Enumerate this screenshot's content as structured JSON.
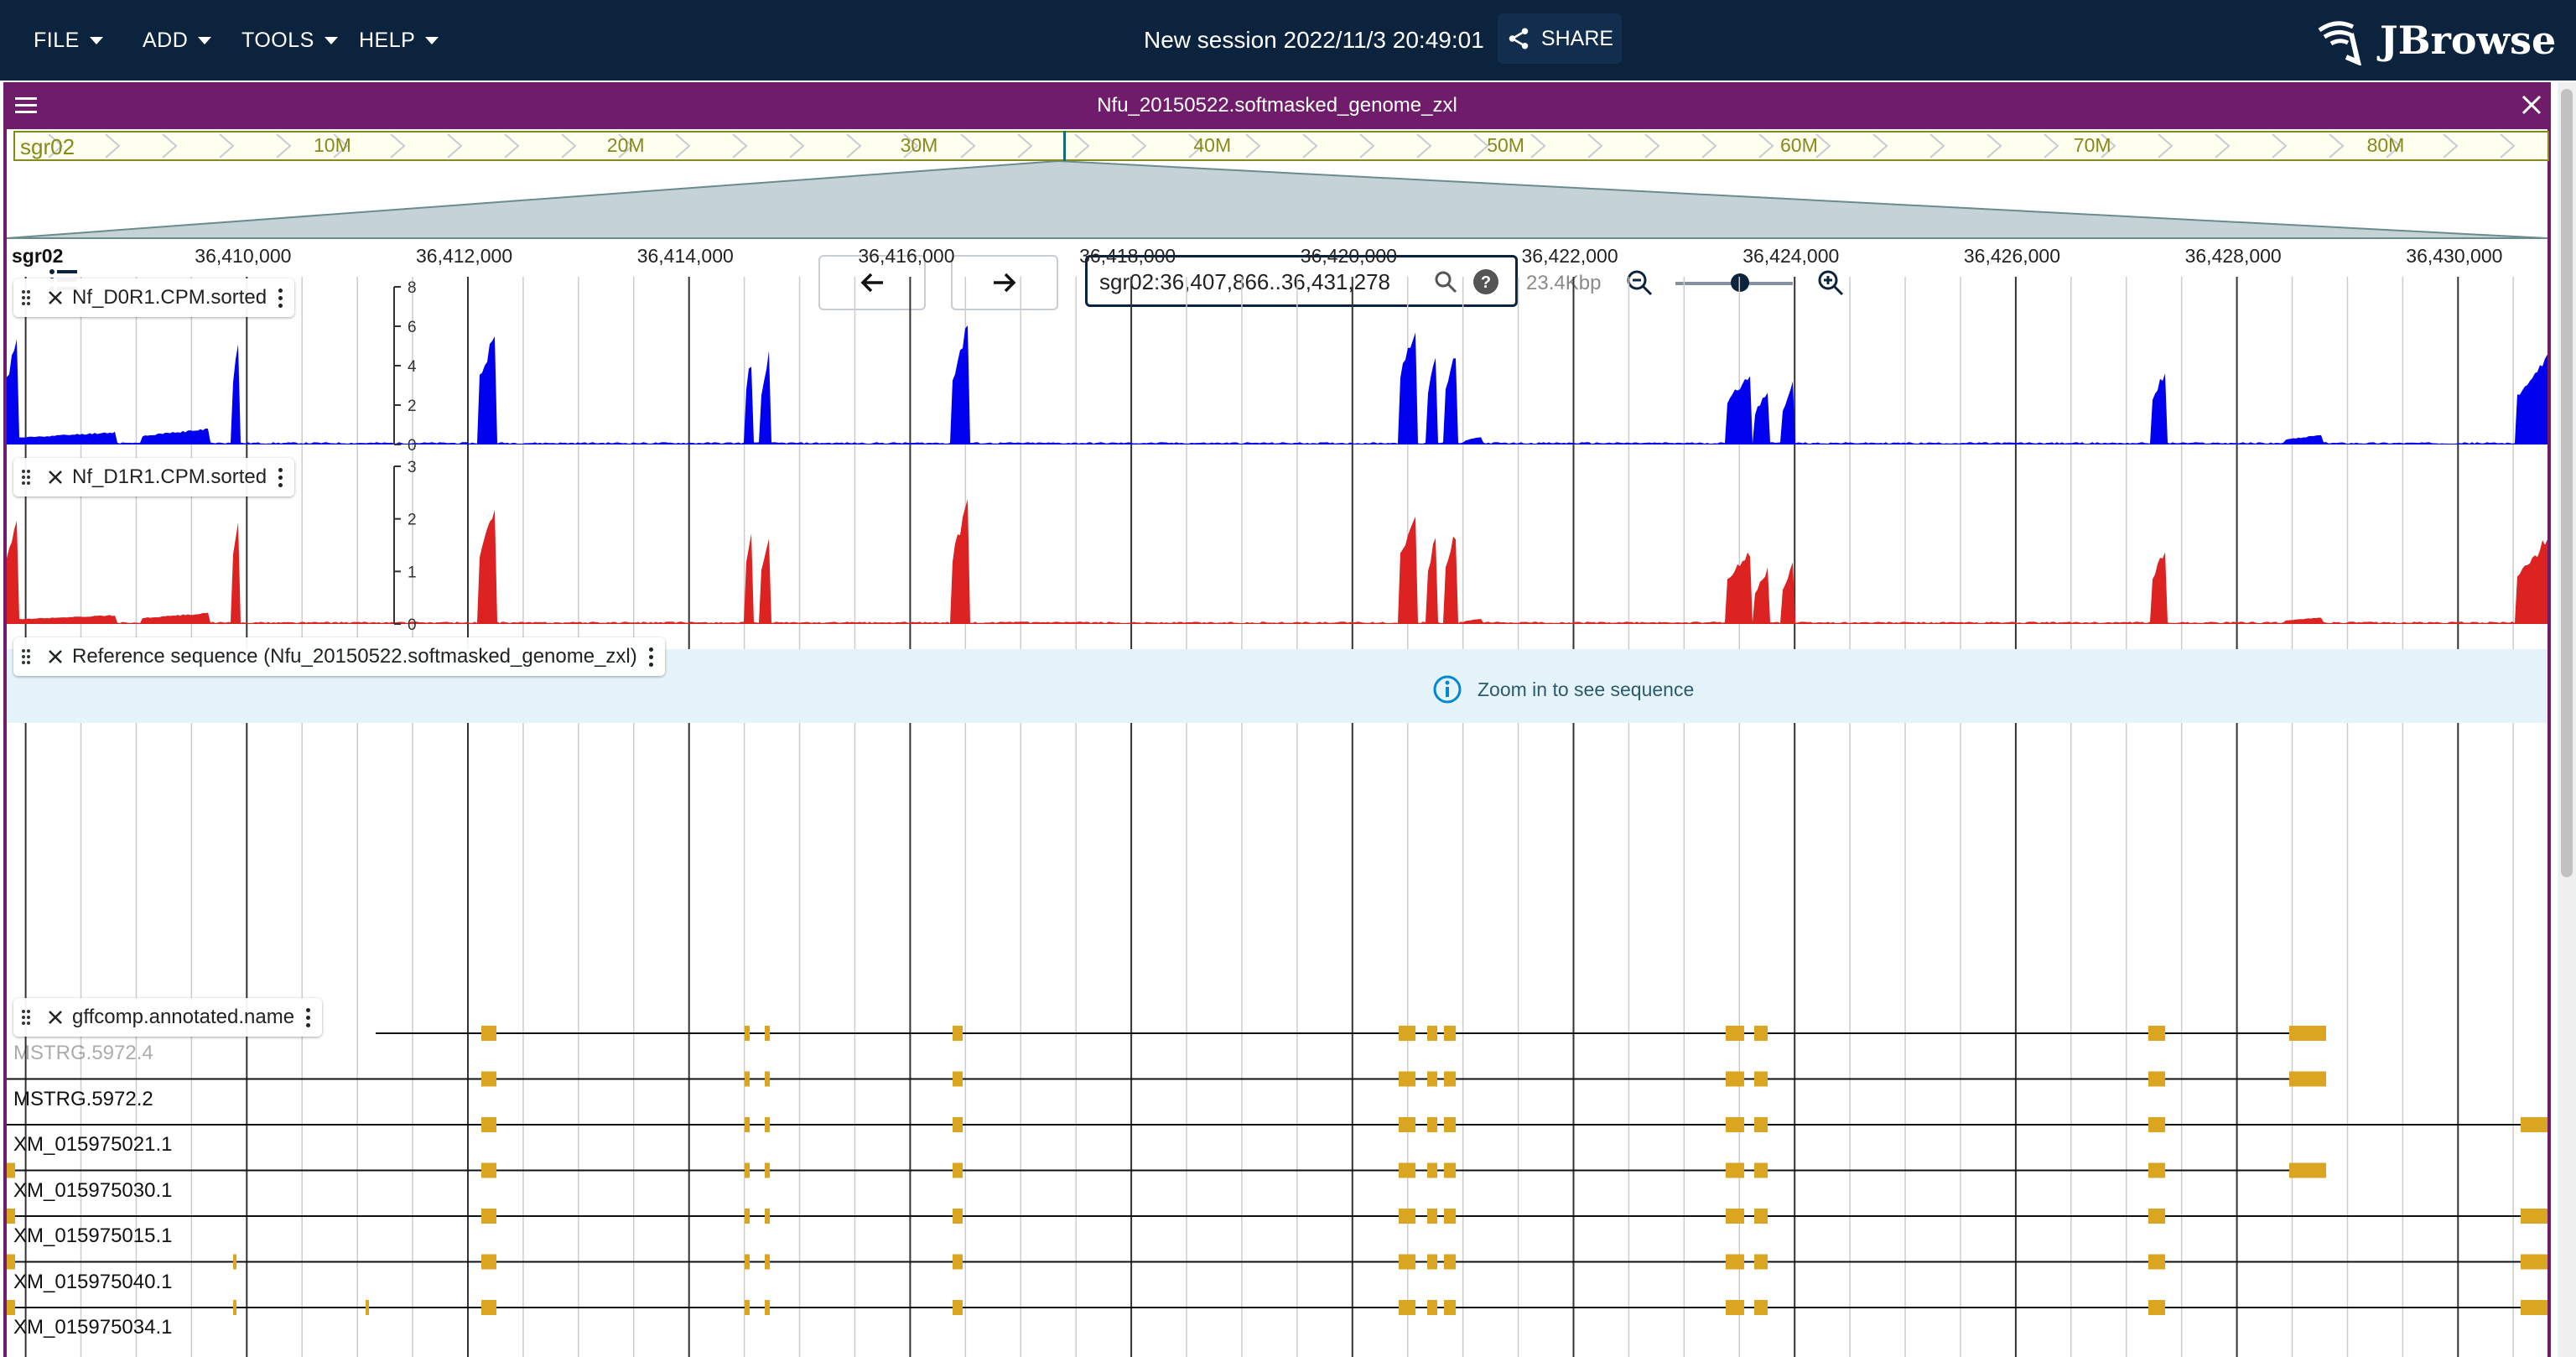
{
  "menus": [
    "FILE",
    "ADD",
    "TOOLS",
    "HELP"
  ],
  "session_title": "New session 2022/11/3 20:49:01",
  "share_label": "SHARE",
  "logo_text": "JBrowse",
  "view": {
    "title": "Nfu_20150522.softmasked_genome_zxl",
    "chrom": "sgr02",
    "overview_labels": [
      "10M",
      "20M",
      "30M",
      "40M",
      "50M",
      "60M",
      "70M",
      "80M"
    ],
    "location": "sgr02:36,407,866..36,431,278",
    "bp_label": "23.4Kbp",
    "zoom_fraction": 0.55
  },
  "ruler": {
    "chrom": "sgr02",
    "labels": [
      "36,410,000",
      "36,412,000",
      "36,414,000",
      "36,416,000",
      "36,418,000",
      "36,420,000",
      "36,422,000",
      "36,424,000",
      "36,426,000",
      "36,428,000",
      "36,430,000"
    ]
  },
  "tracks": [
    {
      "name": "Nf_D0R1.CPM.sorted",
      "color": "#0000ee",
      "ticks": [
        "8",
        "6",
        "4",
        "2",
        "0"
      ]
    },
    {
      "name": "Nf_D1R1.CPM.sorted",
      "color": "#dd2222",
      "ticks": [
        "3",
        "2",
        "1",
        "0"
      ]
    }
  ],
  "reference": {
    "name": "Reference sequence (Nfu_20150522.softmasked_genome_zxl)",
    "zoom_msg": "Zoom in to see sequence"
  },
  "gff": {
    "name": "gffcomp.annotated.name",
    "color": "#daa520",
    "features": [
      "MSTRG.5972.4",
      "MSTRG.5972.2",
      "XM_015975021.1",
      "XM_015975030.1",
      "XM_015975015.1",
      "XM_015975040.1",
      "XM_015975034.1"
    ]
  }
}
